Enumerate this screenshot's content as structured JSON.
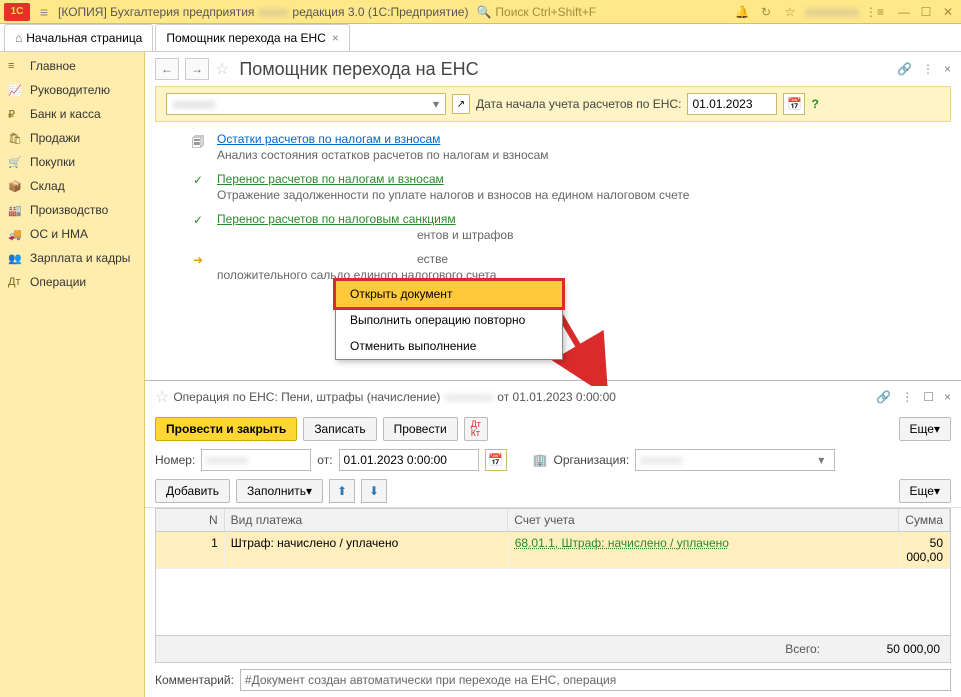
{
  "titlebar": {
    "app_title": "[КОПИЯ] Бухгалтерия предприятия",
    "app_suffix": "редакция 3.0  (1С:Предприятие)",
    "search_placeholder": "Поиск Ctrl+Shift+F"
  },
  "tabs": {
    "home": "Начальная страница",
    "second": "Помощник перехода на ЕНС"
  },
  "nav": [
    {
      "icon": "≡",
      "label": "Главное"
    },
    {
      "icon": "📈",
      "label": "Руководителю"
    },
    {
      "icon": "₽",
      "label": "Банк и касса"
    },
    {
      "icon": "🛍",
      "label": "Продажи"
    },
    {
      "icon": "🛒",
      "label": "Покупки"
    },
    {
      "icon": "📦",
      "label": "Склад"
    },
    {
      "icon": "🏭",
      "label": "Производство"
    },
    {
      "icon": "🚚",
      "label": "ОС и НМА"
    },
    {
      "icon": "👥",
      "label": "Зарплата и кадры"
    },
    {
      "icon": "Дт",
      "label": "Операции"
    }
  ],
  "upper": {
    "title": "Помощник перехода на ЕНС",
    "date_label": "Дата начала учета расчетов по ЕНС:",
    "date_value": "01.01.2023",
    "steps": [
      {
        "icon": "🗐",
        "link": "Остатки расчетов по налогам и взносам",
        "link_class": "",
        "desc": "Анализ состояния остатков расчетов по налогам и взносам"
      },
      {
        "icon": "✓",
        "link": "Перенос расчетов по налогам и взносам",
        "link_class": "green",
        "desc": "Отражение задолженности по уплате налогов и взносов на едином налоговом счете"
      },
      {
        "icon": "✓",
        "link": "Перенос расчетов по налоговым санкциям",
        "link_class": "green",
        "desc": "ентов и штрафов"
      },
      {
        "icon": "➔",
        "link": "",
        "link_class": "",
        "desc": "естве\nположительного сальдо единого налогового счета"
      }
    ]
  },
  "context_menu": {
    "items": [
      "Открыть документ",
      "Выполнить операцию повторно",
      "Отменить выполнение"
    ]
  },
  "doc": {
    "title_prefix": "Операция по ЕНС: Пени, штрафы (начисление)",
    "title_suffix": "от 01.01.2023 0:00:00",
    "btn_post_close": "Провести и закрыть",
    "btn_write": "Записать",
    "btn_post": "Провести",
    "btn_more": "Еще",
    "lbl_number": "Номер:",
    "lbl_from": "от:",
    "date_value": "01.01.2023  0:00:00",
    "lbl_org": "Организация:",
    "btn_add": "Добавить",
    "btn_fill": "Заполнить",
    "grid_headers": {
      "n": "N",
      "vid": "Вид платежа",
      "acc": "Счет учета",
      "sum": "Сумма"
    },
    "rows": [
      {
        "n": "1",
        "vid": "Штраф: начислено / уплачено",
        "acc": "68.01.1, Штраф: начислено / уплачено",
        "sum": "50 000,00"
      }
    ],
    "total_label": "Всего:",
    "total_value": "50 000,00",
    "comment_label": "Комментарий:",
    "comment_value": "#Документ создан автоматически при переходе на ЕНС, операция"
  }
}
